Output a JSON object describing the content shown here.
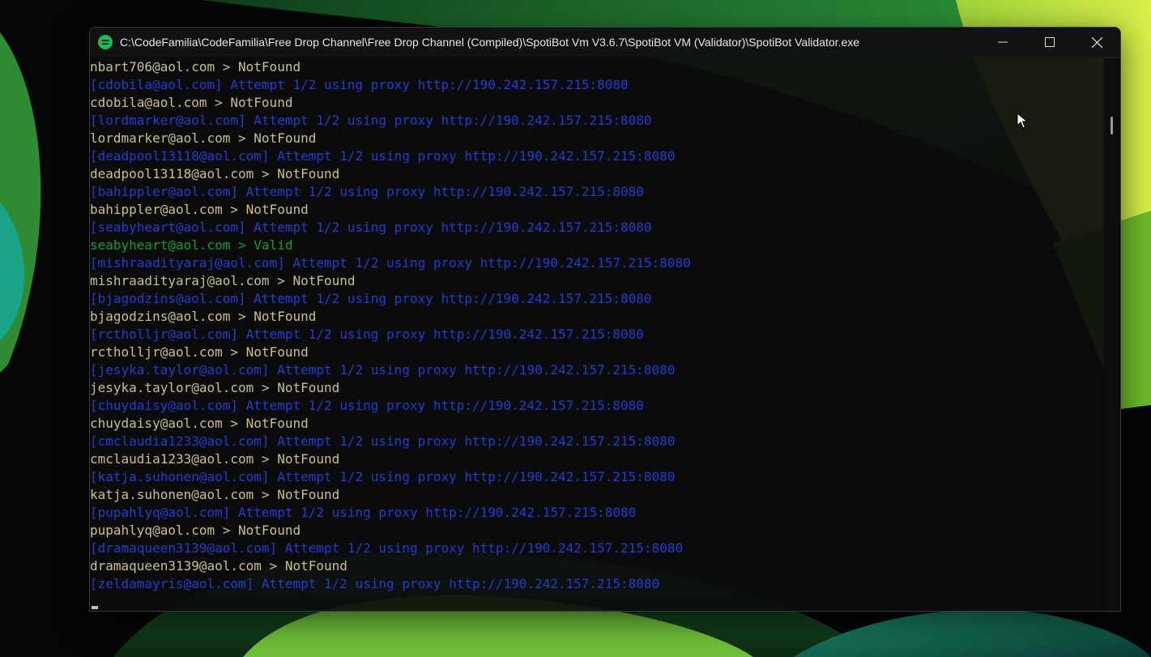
{
  "window": {
    "title": "C:\\CodeFamilia\\CodeFamilia\\Free Drop Channel\\Free Drop Channel (Compiled)\\SpotiBot Vm V3.6.7\\SpotiBot VM (Validator)\\SpotiBot Validator.exe",
    "app_icon": "spotify-icon",
    "controls": [
      "minimize-icon",
      "maximize-icon",
      "close-icon"
    ]
  },
  "colors": {
    "attempt": "#1d3fd2",
    "notfound": "#c9c08a",
    "valid": "#139c31"
  },
  "console": {
    "lines": [
      {
        "text": "nbart706@aol.com > NotFound",
        "type": "notfound"
      },
      {
        "text": "[cdobila@aol.com] Attempt 1/2 using proxy http://190.242.157.215:8080",
        "type": "attempt"
      },
      {
        "text": "cdobila@aol.com > NotFound",
        "type": "notfound"
      },
      {
        "text": "[lordmarker@aol.com] Attempt 1/2 using proxy http://190.242.157.215:8080",
        "type": "attempt"
      },
      {
        "text": "lordmarker@aol.com > NotFound",
        "type": "notfound"
      },
      {
        "text": "[deadpool13118@aol.com] Attempt 1/2 using proxy http://190.242.157.215:8080",
        "type": "attempt"
      },
      {
        "text": "deadpool13118@aol.com > NotFound",
        "type": "notfound"
      },
      {
        "text": "[bahippler@aol.com] Attempt 1/2 using proxy http://190.242.157.215:8080",
        "type": "attempt"
      },
      {
        "text": "bahippler@aol.com > NotFound",
        "type": "notfound"
      },
      {
        "text": "[seabyheart@aol.com] Attempt 1/2 using proxy http://190.242.157.215:8080",
        "type": "attempt"
      },
      {
        "text": "seabyheart@aol.com > Valid",
        "type": "valid"
      },
      {
        "text": "[mishraadityaraj@aol.com] Attempt 1/2 using proxy http://190.242.157.215:8080",
        "type": "attempt"
      },
      {
        "text": "mishraadityaraj@aol.com > NotFound",
        "type": "notfound"
      },
      {
        "text": "[bjagodzins@aol.com] Attempt 1/2 using proxy http://190.242.157.215:8080",
        "type": "attempt"
      },
      {
        "text": "bjagodzins@aol.com > NotFound",
        "type": "notfound"
      },
      {
        "text": "[rctholljr@aol.com] Attempt 1/2 using proxy http://190.242.157.215:8080",
        "type": "attempt"
      },
      {
        "text": "rctholljr@aol.com > NotFound",
        "type": "notfound"
      },
      {
        "text": "[jesyka.taylor@aol.com] Attempt 1/2 using proxy http://190.242.157.215:8080",
        "type": "attempt"
      },
      {
        "text": "jesyka.taylor@aol.com > NotFound",
        "type": "notfound"
      },
      {
        "text": "[chuydaisy@aol.com] Attempt 1/2 using proxy http://190.242.157.215:8080",
        "type": "attempt"
      },
      {
        "text": "chuydaisy@aol.com > NotFound",
        "type": "notfound"
      },
      {
        "text": "[cmclaudia1233@aol.com] Attempt 1/2 using proxy http://190.242.157.215:8080",
        "type": "attempt"
      },
      {
        "text": "cmclaudia1233@aol.com > NotFound",
        "type": "notfound"
      },
      {
        "text": "[katja.suhonen@aol.com] Attempt 1/2 using proxy http://190.242.157.215:8080",
        "type": "attempt"
      },
      {
        "text": "katja.suhonen@aol.com > NotFound",
        "type": "notfound"
      },
      {
        "text": "[pupahlyq@aol.com] Attempt 1/2 using proxy http://190.242.157.215:8080",
        "type": "attempt"
      },
      {
        "text": "pupahlyq@aol.com > NotFound",
        "type": "notfound"
      },
      {
        "text": "[dramaqueen3139@aol.com] Attempt 1/2 using proxy http://190.242.157.215:8080",
        "type": "attempt"
      },
      {
        "text": "dramaqueen3139@aol.com > NotFound",
        "type": "notfound"
      },
      {
        "text": "[zeldamayris@aol.com] Attempt 1/2 using proxy http://190.242.157.215:8080",
        "type": "attempt"
      }
    ]
  }
}
